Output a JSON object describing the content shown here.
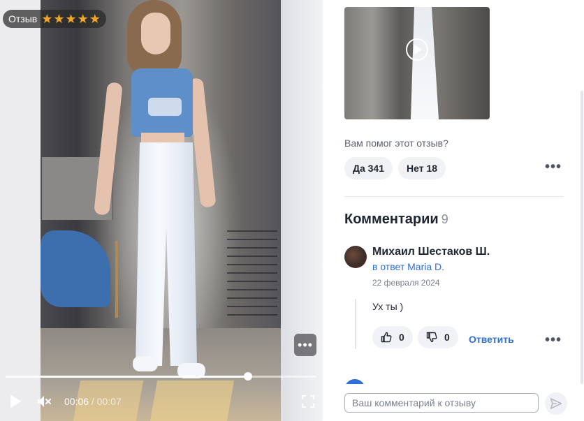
{
  "video": {
    "badge_label": "Отзыв",
    "rating": 5,
    "stars": [
      "★",
      "★",
      "★",
      "★",
      "★"
    ],
    "progress": 0.78,
    "current_time": "00:06",
    "separator": " / ",
    "duration": "00:07",
    "more_label": "•••"
  },
  "review": {
    "helpful_question": "Вам помог этот отзыв?",
    "yes_label": "Да 341",
    "no_label": "Нет 18",
    "more_label": "•••"
  },
  "comments": {
    "title": "Комментарии",
    "count": "9",
    "items": [
      {
        "author": "Михаил Шестаков Ш.",
        "reply_to": "в ответ Maria D.",
        "date": "22 февраля 2024",
        "text": "Ух ты )",
        "likes": "0",
        "dislikes": "0",
        "reply_label": "Ответить",
        "more_label": "•••"
      }
    ]
  },
  "composer": {
    "placeholder": "Ваш комментарий к отзыву"
  },
  "colors": {
    "accent": "#2f6fd6",
    "star": "#f5a623",
    "chip_bg": "#f1f2f5"
  },
  "icons": [
    "star-icon",
    "play-icon",
    "mute-icon",
    "fullscreen-icon",
    "more-icon",
    "thumbs-up-icon",
    "thumbs-down-icon",
    "send-icon"
  ]
}
